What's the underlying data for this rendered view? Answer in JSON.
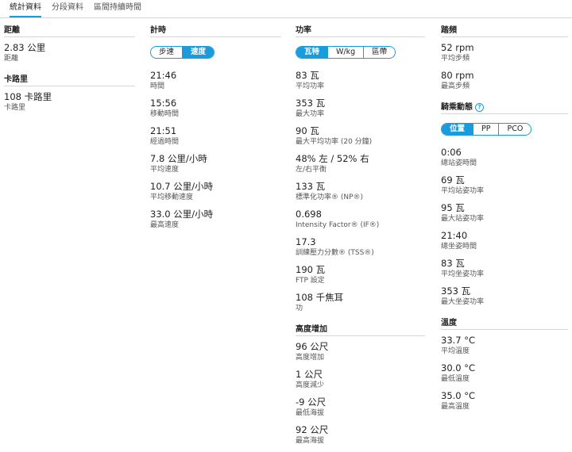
{
  "tabs": [
    "統計資料",
    "分段資料",
    "區間持續時間"
  ],
  "distance": {
    "title": "距離",
    "value": "2.83 公里",
    "label": "距離"
  },
  "calories": {
    "title": "卡路里",
    "value": "108 卡路里",
    "label": "卡路里"
  },
  "timing": {
    "title": "計時",
    "toggle": [
      "步速",
      "速度"
    ],
    "metrics": [
      {
        "value": "21:46",
        "label": "時間"
      },
      {
        "value": "15:56",
        "label": "移動時間"
      },
      {
        "value": "21:51",
        "label": "經過時間"
      },
      {
        "value": "7.8 公里/小時",
        "label": "平均速度"
      },
      {
        "value": "10.7 公里/小時",
        "label": "平均移動速度"
      },
      {
        "value": "33.0 公里/小時",
        "label": "最高速度"
      }
    ]
  },
  "power": {
    "title": "功率",
    "toggle": [
      "瓦特",
      "W/kg",
      "區帶"
    ],
    "metrics": [
      {
        "value": "83 瓦",
        "label": "平均功率"
      },
      {
        "value": "353 瓦",
        "label": "最大功率"
      },
      {
        "value": "90 瓦",
        "label": "最大平均功率 (20 分鐘)"
      },
      {
        "value": "48% 左 / 52% 右",
        "label": "左/右平衡"
      },
      {
        "value": "133 瓦",
        "label": "標準化功率® (NP®)"
      },
      {
        "value": "0.698",
        "label": "Intensity Factor® (IF®)"
      },
      {
        "value": "17.3",
        "label": "訓練壓力分數® (TSS®)"
      },
      {
        "value": "190 瓦",
        "label": "FTP 設定"
      },
      {
        "value": "108 千焦耳",
        "label": "功"
      }
    ]
  },
  "elevation": {
    "title": "高度增加",
    "metrics": [
      {
        "value": "96 公尺",
        "label": "高度增加"
      },
      {
        "value": "1 公尺",
        "label": "高度減少"
      },
      {
        "value": "-9 公尺",
        "label": "最低海拔"
      },
      {
        "value": "92 公尺",
        "label": "最高海拔"
      }
    ]
  },
  "cadence": {
    "title": "踏頻",
    "metrics": [
      {
        "value": "52 rpm",
        "label": "平均步頻"
      },
      {
        "value": "80 rpm",
        "label": "最高步頻"
      }
    ]
  },
  "dynamics": {
    "title": "騎乘動態",
    "help_icon": "question-circle-icon",
    "help_glyph": "?",
    "toggle": [
      "位置",
      "PP",
      "PCO"
    ],
    "metrics": [
      {
        "value": "0:06",
        "label": "總站姿時間"
      },
      {
        "value": "69 瓦",
        "label": "平均站姿功率"
      },
      {
        "value": "95 瓦",
        "label": "最大站姿功率"
      },
      {
        "value": "21:40",
        "label": "總坐姿時間"
      },
      {
        "value": "83 瓦",
        "label": "平均坐姿功率"
      },
      {
        "value": "353 瓦",
        "label": "最大坐姿功率"
      }
    ]
  },
  "temperature": {
    "title": "溫度",
    "metrics": [
      {
        "value": "33.7 °C",
        "label": "平均溫度"
      },
      {
        "value": "30.0 °C",
        "label": "最低溫度"
      },
      {
        "value": "35.0 °C",
        "label": "最高溫度"
      }
    ]
  },
  "colors": {
    "accent": "#1a9bdc",
    "divider": "#d6d6d6"
  }
}
